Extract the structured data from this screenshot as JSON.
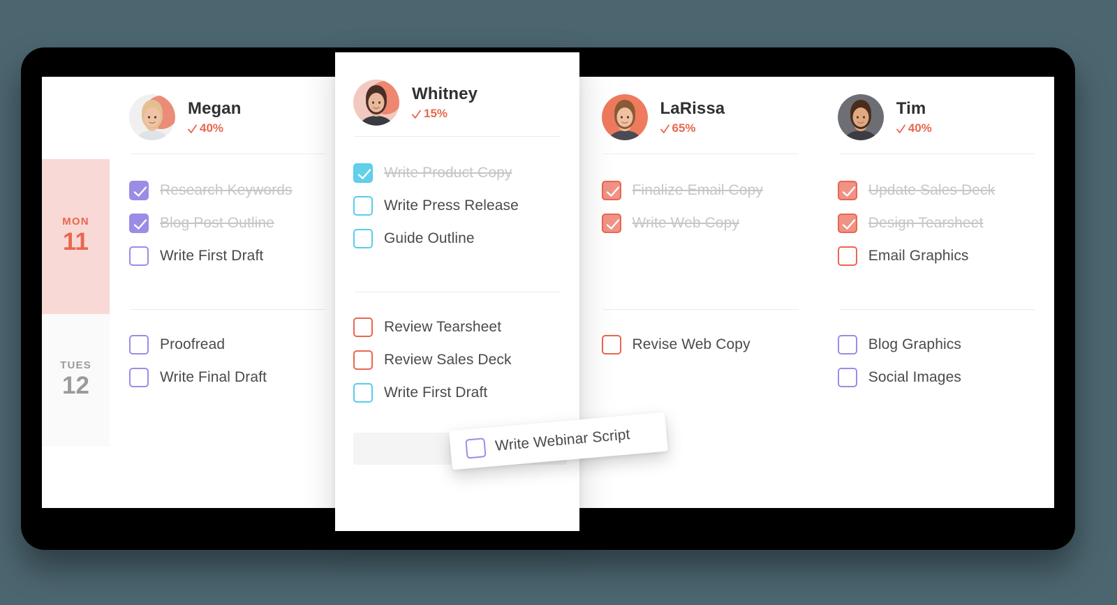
{
  "theme": {
    "background": "#4c6670",
    "bezel": "#000000",
    "screen": "#ffffff",
    "accent_coral": "#e8674f",
    "purple": "#9b8ce6",
    "cyan": "#57ceeb",
    "coral_box": "#f09286",
    "monday_highlight": "#f8d9d5",
    "done_text": "#c6c6c8",
    "task_text": "#4a4a4d"
  },
  "days": [
    {
      "dow": "MON",
      "num": "11",
      "active": true
    },
    {
      "dow": "TUES",
      "num": "12",
      "active": false
    }
  ],
  "columns": [
    {
      "name": "Megan",
      "percent": "40%",
      "color": "purple",
      "avatar": "avatar-megan",
      "monday": [
        {
          "label": "Research Keywords",
          "done": true
        },
        {
          "label": "Blog Post Outline",
          "done": true
        },
        {
          "label": "Write First Draft",
          "done": false
        }
      ],
      "tuesday": [
        {
          "label": "Proofread",
          "done": false
        },
        {
          "label": "Write Final Draft",
          "done": false
        }
      ]
    },
    {
      "name": "Whitney",
      "percent": "15%",
      "color": "cyan",
      "avatar": "avatar-whitney",
      "monday": [
        {
          "label": "Write Product Copy",
          "done": true
        },
        {
          "label": "Write Press Release",
          "done": false
        },
        {
          "label": "Guide Outline",
          "done": false
        }
      ],
      "tuesday": [
        {
          "label": "Review Tearsheet",
          "done": false,
          "color": "coral"
        },
        {
          "label": "Review Sales Deck",
          "done": false,
          "color": "coral"
        },
        {
          "label": "Write First Draft",
          "done": false,
          "color": "cyan"
        }
      ]
    },
    {
      "name": "LaRissa",
      "percent": "65%",
      "color": "coral",
      "avatar": "avatar-larissa",
      "monday": [
        {
          "label": "Finalize Email Copy",
          "done": true
        },
        {
          "label": "Write Web Copy",
          "done": true
        }
      ],
      "tuesday": [
        {
          "label": "Revise Web Copy",
          "done": false,
          "color": "coral"
        }
      ]
    },
    {
      "name": "Tim",
      "percent": "40%",
      "color": "coral",
      "avatar": "avatar-tim",
      "monday": [
        {
          "label": "Update Sales Deck",
          "done": true
        },
        {
          "label": "Design Tearsheet",
          "done": true
        },
        {
          "label": "Email Graphics",
          "done": false
        }
      ],
      "tuesday": [
        {
          "label": "Blog Graphics",
          "done": false,
          "color": "purple"
        },
        {
          "label": "Social Images",
          "done": false,
          "color": "purple"
        }
      ]
    }
  ],
  "drag_card": {
    "label": "Write Webinar Script",
    "color": "purple",
    "checked": false
  }
}
